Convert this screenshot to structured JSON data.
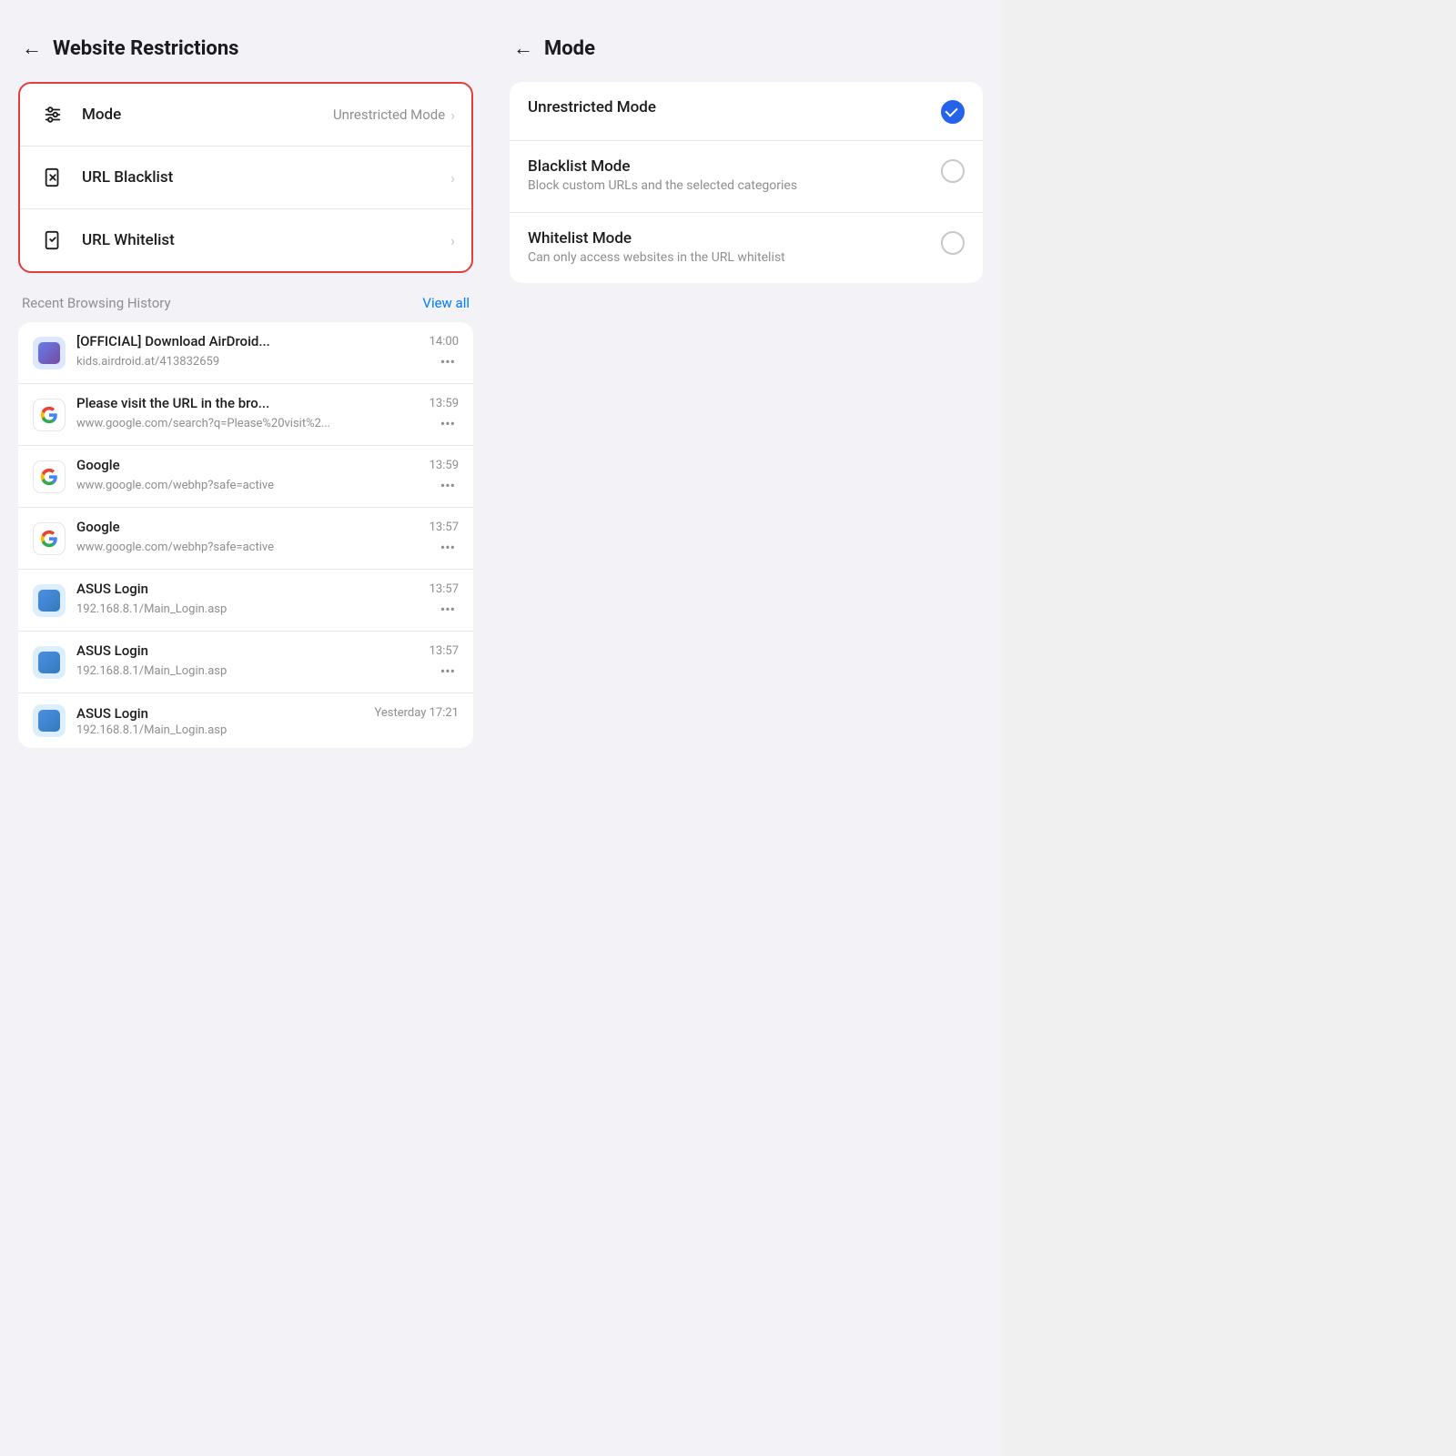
{
  "left": {
    "back_label": "←",
    "title": "Website Restrictions",
    "settings_items": [
      {
        "id": "mode",
        "icon": "sliders",
        "label": "Mode",
        "value": "Unrestricted Mode",
        "highlighted": true
      },
      {
        "id": "url_blacklist",
        "icon": "blacklist",
        "label": "URL Blacklist",
        "value": "",
        "highlighted": false
      },
      {
        "id": "url_whitelist",
        "icon": "whitelist",
        "label": "URL Whitelist",
        "value": "",
        "highlighted": false
      }
    ],
    "history_section_label": "Recent Browsing History",
    "view_all_label": "View all",
    "history_items": [
      {
        "id": "h1",
        "icon_type": "airdroid",
        "title": "[OFFICIAL] Download AirDroid...",
        "url": "kids.airdroid.at/413832659",
        "time": "14:00"
      },
      {
        "id": "h2",
        "icon_type": "google",
        "title": "Please visit the URL in the bro...",
        "url": "www.google.com/search?q=Please%20visit%2...",
        "time": "13:59"
      },
      {
        "id": "h3",
        "icon_type": "google",
        "title": "Google",
        "url": "www.google.com/webhp?safe=active",
        "time": "13:59"
      },
      {
        "id": "h4",
        "icon_type": "google",
        "title": "Google",
        "url": "www.google.com/webhp?safe=active",
        "time": "13:57"
      },
      {
        "id": "h5",
        "icon_type": "asus",
        "title": "ASUS Login",
        "url": "192.168.8.1/Main_Login.asp",
        "time": "13:57"
      },
      {
        "id": "h6",
        "icon_type": "asus",
        "title": "ASUS Login",
        "url": "192.168.8.1/Main_Login.asp",
        "time": "13:57"
      },
      {
        "id": "h7",
        "icon_type": "asus",
        "title": "ASUS Login",
        "url": "192.168.8.1/Main_Login.asp",
        "time": "Yesterday 17:21"
      }
    ]
  },
  "right": {
    "back_label": "←",
    "title": "Mode",
    "mode_items": [
      {
        "id": "unrestricted",
        "label": "Unrestricted Mode",
        "desc": "",
        "selected": true
      },
      {
        "id": "blacklist",
        "label": "Blacklist Mode",
        "desc": "Block custom URLs and the selected categories",
        "selected": false
      },
      {
        "id": "whitelist",
        "label": "Whitelist Mode",
        "desc": "Can only access websites in the URL whitelist",
        "selected": false
      }
    ]
  }
}
